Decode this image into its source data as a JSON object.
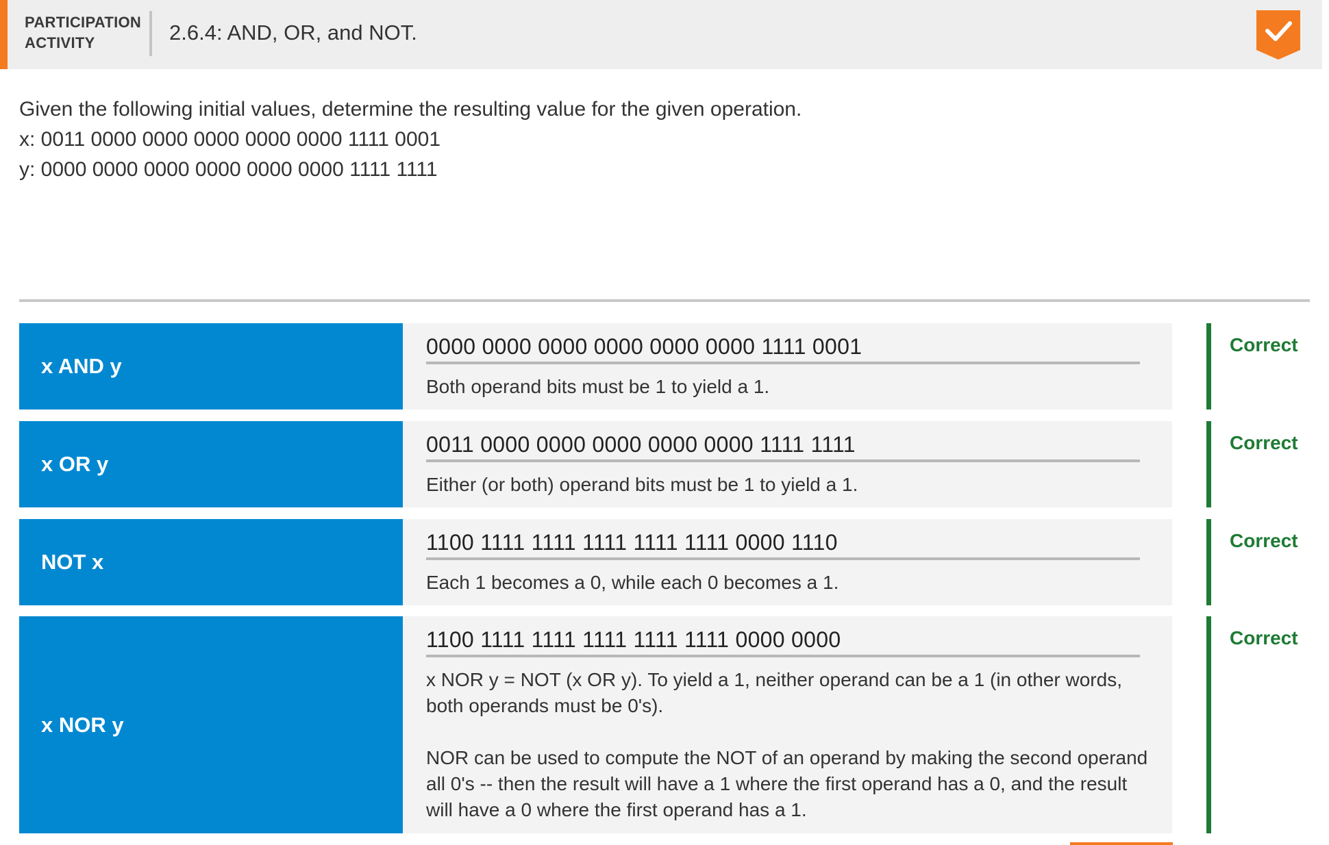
{
  "header": {
    "type_line1": "PARTICIPATION",
    "type_line2": "ACTIVITY",
    "title": "2.6.4: AND, OR, and NOT.",
    "completion_icon": "check-icon",
    "accent_color": "#f47b20"
  },
  "instructions": {
    "line1": "Given the following initial values, determine the resulting value for the given operation.",
    "line2": "x: 0011 0000 0000 0000 0000 0000 1111 0001",
    "line3": "y: 0000 0000 0000 0000 0000 0000 1111 1111"
  },
  "colors": {
    "prompt_bg": "#0288d1",
    "correct": "#1e7b34"
  },
  "questions": [
    {
      "prompt": "x AND y",
      "answer": "0000 0000 0000 0000 0000 0000 1111 0001",
      "explanation": [
        "Both operand bits must be 1 to yield a 1."
      ],
      "status": "Correct"
    },
    {
      "prompt": "x OR y",
      "answer": "0011 0000 0000 0000 0000 0000 1111 1111",
      "explanation": [
        "Either (or both) operand bits must be 1 to yield a 1."
      ],
      "status": "Correct"
    },
    {
      "prompt": "NOT x",
      "answer": "1100 1111 1111 1111 1111 1111 0000 1110",
      "explanation": [
        "Each 1 becomes a 0, while each 0 becomes a 1."
      ],
      "status": "Correct"
    },
    {
      "prompt": "x NOR y",
      "answer": "1100 1111 1111 1111 1111 1111 0000 0000",
      "explanation": [
        "x NOR y = NOT (x OR y). To yield a 1, neither operand can be a 1 (in other words, both operands must be 0's).",
        "NOR can be used to compute the NOT of an operand by making the second operand all 0's -- then the result will have a 1 where the first operand has a 0, and the result will have a 0 where the first operand has a 1."
      ],
      "status": "Correct"
    }
  ]
}
